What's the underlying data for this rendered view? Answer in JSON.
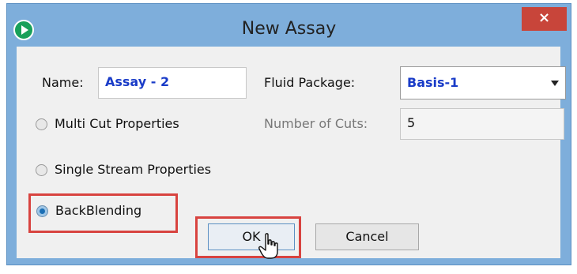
{
  "window": {
    "title": "New Assay",
    "close_label": "×"
  },
  "form": {
    "name_label": "Name:",
    "name_value": "Assay - 2",
    "fluid_package_label": "Fluid Package:",
    "fluid_package_value": "Basis-1",
    "cuts_label": "Number of Cuts:",
    "cuts_value": "5"
  },
  "options": [
    {
      "label": "Multi Cut Properties",
      "checked": false
    },
    {
      "label": "Single Stream Properties",
      "checked": false
    },
    {
      "label": "BackBlending",
      "checked": true
    }
  ],
  "buttons": {
    "ok_label": "OK",
    "cancel_label": "Cancel"
  },
  "colors": {
    "title_bar": "#7eaedb",
    "close": "#c8453a",
    "highlight": "#d8433f",
    "value_text": "#1a3cc8"
  },
  "icons": {
    "app": "play-circle-icon",
    "cursor": "hand-pointer-icon"
  }
}
